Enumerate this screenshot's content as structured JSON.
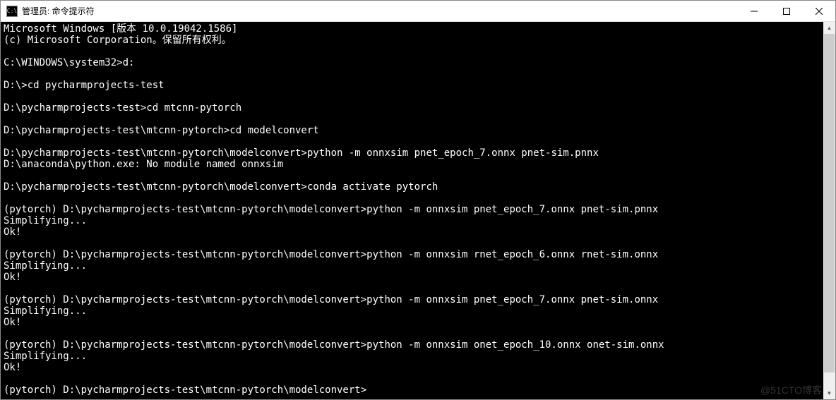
{
  "window": {
    "title": "管理员: 命令提示符",
    "icon_text": "C:\\"
  },
  "terminal": {
    "lines": [
      "Microsoft Windows [版本 10.0.19042.1586]",
      "(c) Microsoft Corporation。保留所有权利。",
      "",
      "C:\\WINDOWS\\system32>d:",
      "",
      "D:\\>cd pycharmprojects-test",
      "",
      "D:\\pycharmprojects-test>cd mtcnn-pytorch",
      "",
      "D:\\pycharmprojects-test\\mtcnn-pytorch>cd modelconvert",
      "",
      "D:\\pycharmprojects-test\\mtcnn-pytorch\\modelconvert>python -m onnxsim pnet_epoch_7.onnx pnet-sim.pnnx",
      "D:\\anaconda\\python.exe: No module named onnxsim",
      "",
      "D:\\pycharmprojects-test\\mtcnn-pytorch\\modelconvert>conda activate pytorch",
      "",
      "(pytorch) D:\\pycharmprojects-test\\mtcnn-pytorch\\modelconvert>python -m onnxsim pnet_epoch_7.onnx pnet-sim.pnnx",
      "Simplifying...",
      "Ok!",
      "",
      "(pytorch) D:\\pycharmprojects-test\\mtcnn-pytorch\\modelconvert>python -m onnxsim rnet_epoch_6.onnx rnet-sim.onnx",
      "Simplifying...",
      "Ok!",
      "",
      "(pytorch) D:\\pycharmprojects-test\\mtcnn-pytorch\\modelconvert>python -m onnxsim pnet_epoch_7.onnx pnet-sim.onnx",
      "Simplifying...",
      "Ok!",
      "",
      "(pytorch) D:\\pycharmprojects-test\\mtcnn-pytorch\\modelconvert>python -m onnxsim onet_epoch_10.onnx onet-sim.onnx",
      "Simplifying...",
      "Ok!",
      "",
      "(pytorch) D:\\pycharmprojects-test\\mtcnn-pytorch\\modelconvert>"
    ]
  },
  "watermark": "@51CTO博客"
}
